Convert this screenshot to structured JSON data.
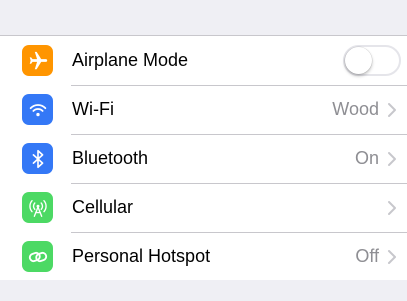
{
  "settings": {
    "rows": [
      {
        "label": "Airplane Mode",
        "value": "",
        "icon": "airplane-icon",
        "color": "#ff9500",
        "control": "toggle",
        "toggle_on": false
      },
      {
        "label": "Wi-Fi",
        "value": "Wood",
        "icon": "wifi-icon",
        "color": "#3478f6",
        "control": "chevron"
      },
      {
        "label": "Bluetooth",
        "value": "On",
        "icon": "bluetooth-icon",
        "color": "#3478f6",
        "control": "chevron"
      },
      {
        "label": "Cellular",
        "value": "",
        "icon": "cellular-icon",
        "color": "#4cd964",
        "control": "chevron"
      },
      {
        "label": "Personal Hotspot",
        "value": "Off",
        "icon": "hotspot-icon",
        "color": "#4cd964",
        "control": "chevron"
      }
    ]
  },
  "colors": {
    "background": "#efeff4",
    "separator": "#c8c7cc",
    "secondary_text": "#8e8e93"
  }
}
